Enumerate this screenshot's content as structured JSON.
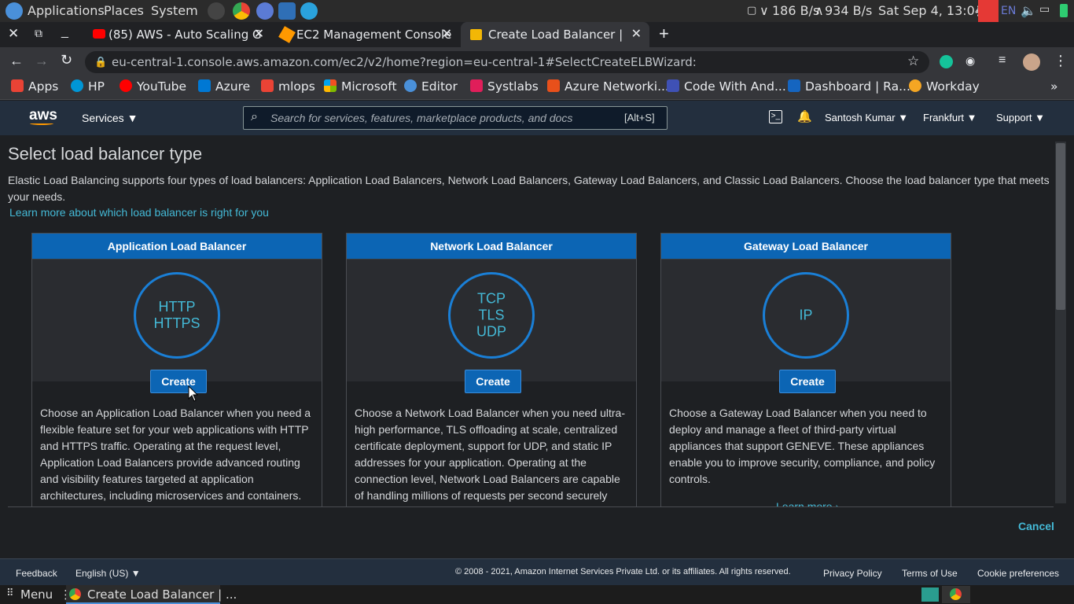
{
  "system_bar": {
    "applications": "Applications",
    "places": "Places",
    "system": "System",
    "network": "186 B/s",
    "network_up": "934 B/s",
    "clock": "Sat Sep  4, 13:04",
    "lang": "EN"
  },
  "tabs": [
    {
      "title": "(85) AWS - Auto Scaling G",
      "icon_color": "#ff0000"
    },
    {
      "title": "EC2 Management Console",
      "icon_color": "#f90"
    },
    {
      "title": "Create Load Balancer | EC",
      "icon_color": "#f2b705",
      "active": true
    }
  ],
  "url": "eu-central-1.console.aws.amazon.com/ec2/v2/home?region=eu-central-1#SelectCreateELBWizard:",
  "bookmarks": [
    {
      "label": "Apps",
      "color": "#ea4335"
    },
    {
      "label": "HP",
      "color": "#0096d6"
    },
    {
      "label": "YouTube",
      "color": "#ff0000"
    },
    {
      "label": "Azure",
      "color": "#0078d4"
    },
    {
      "label": "mlops",
      "color": "#ea4335"
    },
    {
      "label": "Microsoft",
      "color": "#f25022"
    },
    {
      "label": "Editor",
      "color": "#4a90d9"
    },
    {
      "label": "Systlabs",
      "color": "#e01e5a"
    },
    {
      "label": "Azure Networki...",
      "color": "#e8501b"
    },
    {
      "label": "Code With And...",
      "color": "#3f51b5"
    },
    {
      "label": "Dashboard | Ra...",
      "color": "#1565c0"
    },
    {
      "label": "Workday",
      "color": "#f5a623"
    }
  ],
  "aws_header": {
    "logo": "aws",
    "services": "Services",
    "search_placeholder": "Search for services, features, marketplace products, and docs",
    "search_shortcut": "[Alt+S]",
    "user": "Santosh Kumar",
    "region": "Frankfurt",
    "support": "Support"
  },
  "page": {
    "title": "Select load balancer type",
    "intro": "Elastic Load Balancing supports four types of load balancers: Application Load Balancers, Network Load Balancers, Gateway Load Balancers, and Classic Load Balancers. Choose the load balancer type that meets your needs.",
    "learn_more": "Learn more about which load balancer is right for you",
    "cancel": "Cancel"
  },
  "cards": [
    {
      "title": "Application Load Balancer",
      "protocols": "HTTP\nHTTPS",
      "button": "Create",
      "description": "Choose an Application Load Balancer when you need a flexible feature set for your web applications with HTTP and HTTPS traffic. Operating at the request level, Application Load Balancers provide advanced routing and visibility features targeted at application architectures, including microservices and containers."
    },
    {
      "title": "Network Load Balancer",
      "protocols": "TCP\nTLS\nUDP",
      "button": "Create",
      "description": "Choose a Network Load Balancer when you need ultra-high performance, TLS offloading at scale, centralized certificate deployment, support for UDP, and static IP addresses for your application. Operating at the connection level, Network Load Balancers are capable of handling millions of requests per second securely"
    },
    {
      "title": "Gateway Load Balancer",
      "protocols": "IP",
      "button": "Create",
      "description": "Choose a Gateway Load Balancer when you need to deploy and manage a fleet of third-party virtual appliances that support GENEVE. These appliances enable you to improve security, compliance, and policy controls.",
      "learn_more": "Learn more ›"
    }
  ],
  "footer": {
    "feedback": "Feedback",
    "language": "English (US)",
    "copyright": "© 2008 - 2021, Amazon Internet Services Private Ltd. or its affiliates. All rights reserved.",
    "privacy": "Privacy Policy",
    "terms": "Terms of Use",
    "cookies": "Cookie preferences"
  },
  "taskbar": {
    "menu": "Menu",
    "window": "Create Load Balancer | ..."
  }
}
